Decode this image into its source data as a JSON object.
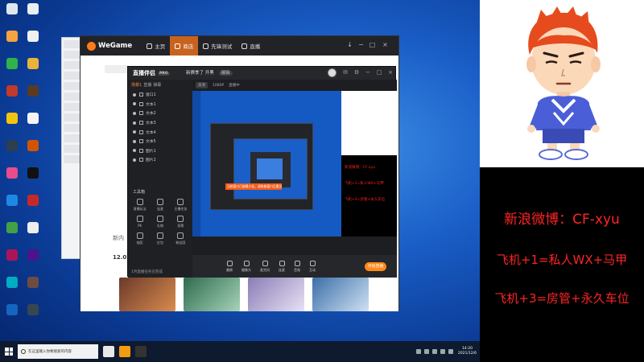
{
  "colors": {
    "accent_orange": "#ff8a1a",
    "wegame_active_tab": "#c7631f",
    "warn_red": "#ff2424",
    "desktop_blue": "#1a5ec7",
    "taskbar": "#0e1a2f"
  },
  "wegame": {
    "logo": "WeGame",
    "tabs": [
      {
        "label": "主页",
        "icon": "home-icon"
      },
      {
        "label": "商店",
        "icon": "store-icon"
      },
      {
        "label": "先锋测试",
        "icon": "test-icon"
      },
      {
        "label": "直播",
        "icon": "live-icon"
      }
    ],
    "left_text": "新内",
    "left_date": "12.02"
  },
  "live": {
    "logo": "直播伴侣",
    "version": "PRO",
    "title": "新赛季了 开黑",
    "title_pill": "编辑",
    "side_tabs": [
      "场景1",
      "直播",
      "弹幕"
    ],
    "sources": [
      "窗口1",
      "文本1",
      "文本2",
      "文本3",
      "文本4",
      "文本5",
      "图片1",
      "图片2"
    ],
    "tools_title": "工具箱",
    "tools": [
      "直播玩法",
      "连麦",
      "主播任务",
      "PK",
      "礼物",
      "投票",
      "抽奖",
      "红包",
      "粉丝团"
    ],
    "side_footer": "1月直播任务已完成",
    "preview_bar": [
      "高清",
      "1080P",
      "直播中"
    ],
    "preview_warning": "当前窗口已被最小化，请恢复窗口后重试",
    "preview_red": [
      "新浪微博：CF-xyu",
      "飞机+1=私人WX+马甲",
      "飞机+3=房管+永久车位"
    ],
    "bottom_tools": [
      "美颜",
      "摄像头",
      "麦克风",
      "连麦",
      "音效",
      "互动"
    ],
    "start_button": "开始直播"
  },
  "taskbar": {
    "search_placeholder": "在这里输入你要搜索的内容",
    "clock_time": "14:20",
    "clock_date": "2021/12/6"
  },
  "overlay": {
    "weibo": "新浪微博：CF-xyu",
    "plane1": "飞机+1=私人WX+马甲",
    "plane3": "飞机+3=房管+永久车位"
  }
}
